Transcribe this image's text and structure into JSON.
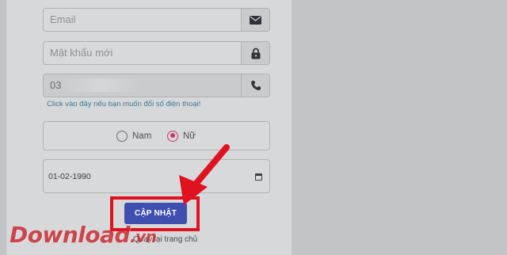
{
  "form": {
    "email_placeholder": "Email",
    "password_placeholder": "Mật khẩu mới",
    "phone_value": "03",
    "change_phone_link": "Click vào đây nếu bạn muốn đổi số điện thoại!",
    "gender": {
      "options": [
        "Nam",
        "Nữ"
      ],
      "selected": "Nữ"
    },
    "dob_value": "01-02-1990",
    "update_button_label": "CẬP NHẬT",
    "home_link": "Quay lại trang chủ"
  },
  "icons": {
    "email": "envelope-icon",
    "password": "lock-icon",
    "phone": "phone-icon",
    "date": "calendar-icon"
  },
  "annotation": {
    "highlight_color": "#e0121f",
    "arrow_color": "#e0121f"
  },
  "watermark": {
    "text": "Download",
    "tld": ".vn"
  },
  "colors": {
    "button": "#3e4fb0",
    "radio_checked": "#c33a66",
    "link": "#3d7a93"
  }
}
